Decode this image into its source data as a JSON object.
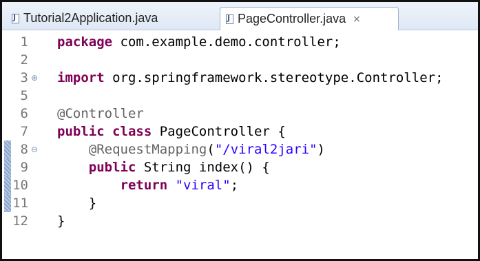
{
  "tabs": [
    {
      "label": "Tutorial2Application.java",
      "icon": "java-file-icon",
      "active": false
    },
    {
      "label": "PageController.java",
      "icon": "java-file-icon",
      "active": true,
      "close": "⨯"
    }
  ],
  "code": {
    "lines": [
      {
        "n": "1",
        "parts": [
          [
            "kw",
            "package"
          ],
          [
            "t",
            " com.example.demo.controller;"
          ]
        ]
      },
      {
        "n": "2",
        "parts": []
      },
      {
        "n": "3",
        "fold": "⊕",
        "parts": [
          [
            "kw",
            "import"
          ],
          [
            "t",
            " org.springframework.stereotype.Controller;"
          ]
        ]
      },
      {
        "n": "5",
        "parts": []
      },
      {
        "n": "6",
        "parts": [
          [
            "ann",
            "@Controller"
          ]
        ]
      },
      {
        "n": "7",
        "parts": [
          [
            "kw",
            "public"
          ],
          [
            "t",
            " "
          ],
          [
            "kw",
            "class"
          ],
          [
            "t",
            " PageController {"
          ]
        ]
      },
      {
        "n": "8",
        "fold": "⊖",
        "marker": true,
        "parts": [
          [
            "t",
            "    "
          ],
          [
            "ann",
            "@RequestMapping"
          ],
          [
            "t",
            "("
          ],
          [
            "str",
            "\"/viral2jari\""
          ],
          [
            "t",
            ")"
          ]
        ]
      },
      {
        "n": "9",
        "marker": true,
        "parts": [
          [
            "t",
            "    "
          ],
          [
            "kw",
            "public"
          ],
          [
            "t",
            " String index() {"
          ]
        ]
      },
      {
        "n": "10",
        "marker": true,
        "parts": [
          [
            "t",
            "        "
          ],
          [
            "kw",
            "return"
          ],
          [
            "t",
            " "
          ],
          [
            "str",
            "\"viral\""
          ],
          [
            "t",
            ";"
          ]
        ]
      },
      {
        "n": "11",
        "marker": true,
        "parts": [
          [
            "t",
            "    }"
          ]
        ]
      },
      {
        "n": "12",
        "parts": [
          [
            "t",
            "}"
          ]
        ]
      }
    ]
  },
  "colors": {
    "keyword": "#7f0055",
    "string": "#2a00ff",
    "annotation": "#646464",
    "line_number": "#787878"
  }
}
